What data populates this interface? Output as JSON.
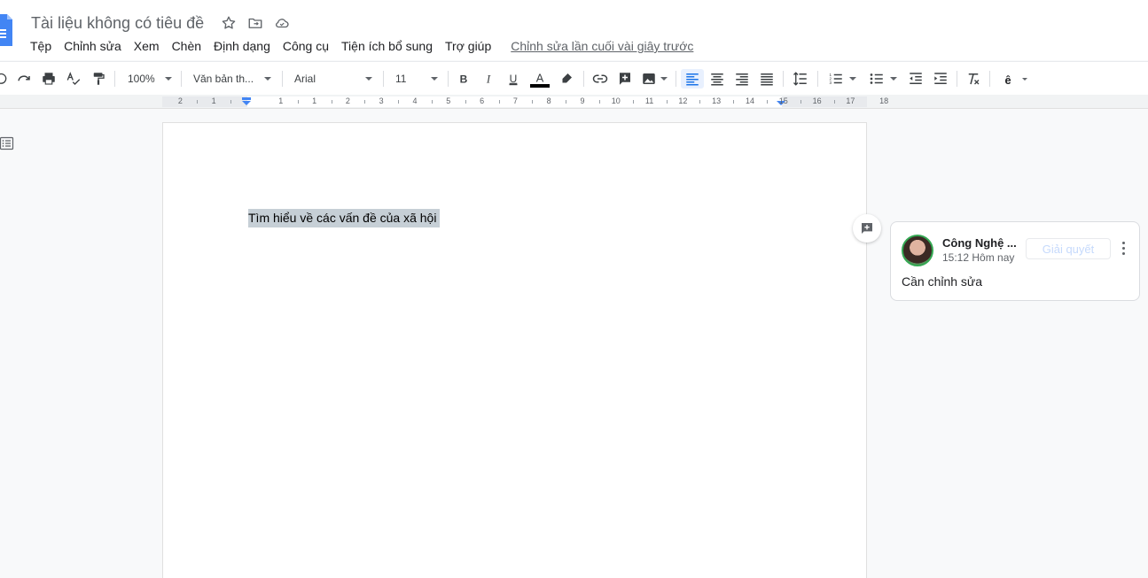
{
  "document": {
    "title": "Tài liệu không có tiêu đề"
  },
  "menu": {
    "items": [
      "Tệp",
      "Chỉnh sửa",
      "Xem",
      "Chèn",
      "Định dạng",
      "Công cụ",
      "Tiện ích bổ sung",
      "Trợ giúp"
    ],
    "last_edit": "Chỉnh sửa lần cuối vài giây trước"
  },
  "toolbar": {
    "zoom": "100%",
    "style": "Văn bản th...",
    "font": "Arial",
    "font_size": "11",
    "text_color": "#000000",
    "accent": "#1a73e8"
  },
  "ruler": {
    "labels": [
      "2",
      "1",
      "1",
      "1",
      "2",
      "3",
      "4",
      "5",
      "6",
      "7",
      "8",
      "9",
      "10",
      "11",
      "12",
      "13",
      "14",
      "15",
      "16",
      "17",
      "18"
    ]
  },
  "body": {
    "paragraph": "Tìm hiểu về các vấn đề của xã hội"
  },
  "comment": {
    "author": "Công Nghệ ...",
    "time": "15:12 Hôm nay",
    "resolve_label": "Giải quyết",
    "text": "Cần chỉnh sửa"
  }
}
